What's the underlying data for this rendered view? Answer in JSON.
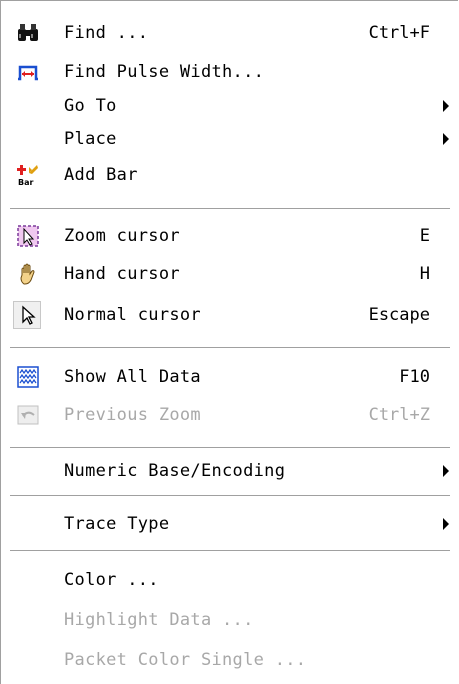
{
  "menu": {
    "items": [
      {
        "label": "Find ...",
        "shortcut": "Ctrl+F",
        "icon": "binoculars-icon"
      },
      {
        "label": "Find Pulse Width...",
        "shortcut": "",
        "icon": "pulse-width-icon"
      },
      {
        "label": "Go To",
        "shortcut": "",
        "icon": "",
        "submenu": true
      },
      {
        "label": "Place",
        "shortcut": "",
        "icon": "",
        "submenu": true
      },
      {
        "label": "Add Bar",
        "shortcut": "",
        "icon": "add-bar-icon",
        "icon_text": "Bar"
      },
      {
        "label": "Zoom cursor",
        "shortcut": "E",
        "icon": "zoom-cursor-icon"
      },
      {
        "label": "Hand cursor",
        "shortcut": "H",
        "icon": "hand-cursor-icon"
      },
      {
        "label": "Normal cursor",
        "shortcut": "Escape",
        "icon": "arrow-cursor-icon",
        "checked": true
      },
      {
        "label": "Show All Data",
        "shortcut": "F10",
        "icon": "waveform-icon"
      },
      {
        "label": "Previous Zoom",
        "shortcut": "Ctrl+Z",
        "icon": "undo-zoom-icon",
        "disabled": true
      },
      {
        "label": "Numeric Base/Encoding",
        "shortcut": "",
        "icon": "",
        "submenu": true
      },
      {
        "label": "Trace Type",
        "shortcut": "",
        "icon": "",
        "submenu": true
      },
      {
        "label": "Color ...",
        "shortcut": "",
        "icon": ""
      },
      {
        "label": "Highlight Data ...",
        "shortcut": "",
        "icon": "",
        "disabled": true
      },
      {
        "label": "Packet Color Single ...",
        "shortcut": "",
        "icon": "",
        "disabled": true
      }
    ]
  },
  "colors": {
    "disabled_text": "#a8a8a8",
    "separator": "#a0a0a0",
    "accent_red": "#e02020",
    "accent_blue": "#1a4fd0"
  }
}
